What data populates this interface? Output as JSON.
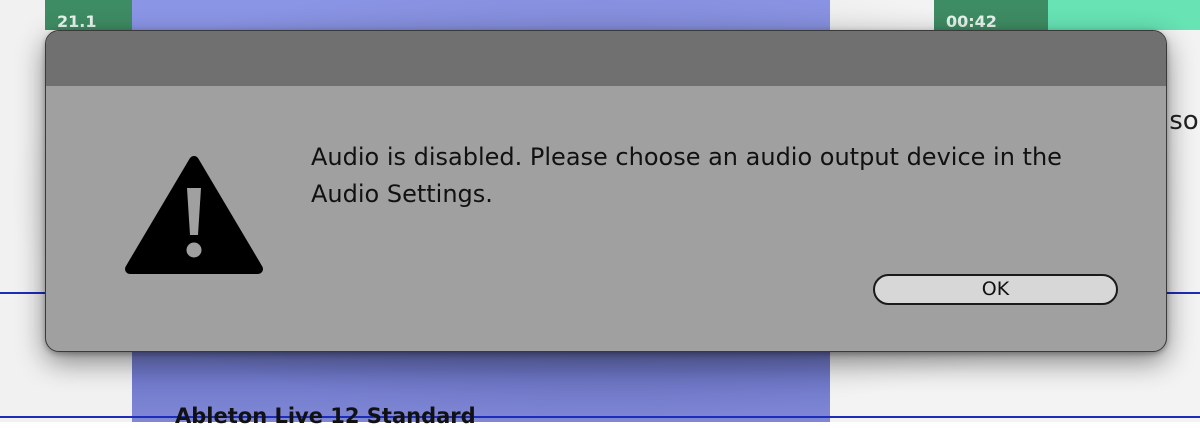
{
  "background": {
    "tab_left_text": "21.1",
    "tab_right_text": "00:42",
    "bottom_text": "Ableton Live 12 Standard",
    "right_edge_text": "iso"
  },
  "dialog": {
    "icon": "warning-triangle-icon",
    "message": "Audio is disabled. Please choose an audio output device in the Audio Settings.",
    "ok_label": "OK"
  },
  "colors": {
    "dialog_body": "#a0a0a0",
    "dialog_titlebar": "#707070",
    "button_fill": "#d7d7d7",
    "background_panel": "#8b95e6",
    "background_tab": "#3e8c63",
    "mint_bar": "#67e3b4",
    "divider_line": "#1c2db8"
  }
}
